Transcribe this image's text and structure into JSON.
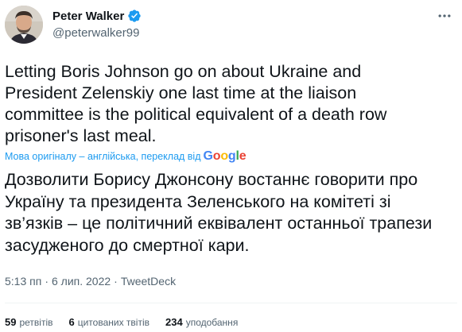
{
  "author": {
    "display_name": "Peter Walker",
    "handle": "@peterwalker99",
    "verified": true
  },
  "icons": {
    "verified": "verified-badge-icon",
    "more": "more-horizontal-icon",
    "google": "google-logo"
  },
  "tweet": {
    "text": "Letting Boris Johnson go on about Ukraine and President Zelenskiy one last time at the liaison committee is the political equivalent of a death row prisoner's last meal.",
    "translation_notice": "Мова оригіналу – англійська, переклад від",
    "translation_provider": "Google",
    "translated_text": "Дозволити Борису Джонсону востаннє говорити про Україну та президента Зеленського на комітеті зі зв’язків – це політичний еквівалент останньої трапези засудженого до смертної кари."
  },
  "meta": {
    "time": "5:13 пп",
    "separator": "·",
    "date": "6 лип. 2022",
    "source": "TweetDeck"
  },
  "stats": {
    "retweets": {
      "count": "59",
      "label": "ретвітів"
    },
    "quotes": {
      "count": "6",
      "label": "цитованих твітів"
    },
    "likes": {
      "count": "234",
      "label": "уподобання"
    }
  },
  "colors": {
    "text_primary": "#0f1419",
    "text_secondary": "#536471",
    "accent": "#1d9bf0",
    "divider": "#eff3f4",
    "google_blue": "#4285F4",
    "google_red": "#EA4335",
    "google_yellow": "#FBBC05",
    "google_green": "#34A853"
  }
}
